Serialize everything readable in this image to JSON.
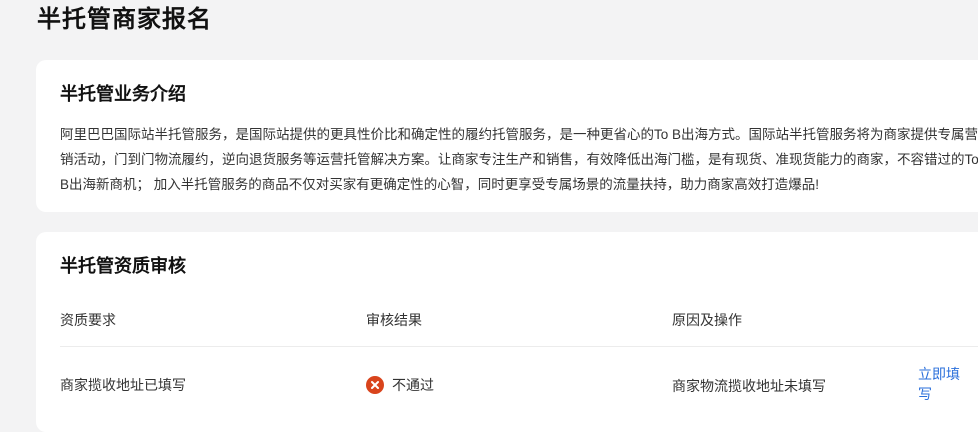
{
  "page": {
    "title": "半托管商家报名"
  },
  "intro": {
    "title": "半托管业务介绍",
    "text": "阿里巴巴国际站半托管服务，是国际站提供的更具性价比和确定性的履约托管服务，是一种更省心的To B出海方式。国际站半托管服务将为商家提供专属营销活动，门到门物流履约，逆向退货服务等运营托管解决方案。让商家专注生产和销售，有效降低出海门槛，是有现货、准现货能力的商家，不容错过的To B出海新商机； 加入半托管服务的商品不仅对买家有更确定性的心智，同时更享受专属场景的流量扶持，助力商家高效打造爆品!"
  },
  "review": {
    "title": "半托管资质审核",
    "columns": [
      "资质要求",
      "审核结果",
      "原因及操作"
    ],
    "rows": [
      {
        "requirement": "商家揽收地址已填写",
        "result": "不通过",
        "result_icon": "error-circle-icon",
        "result_color": "#d9441c",
        "reason": "商家物流揽收地址未填写",
        "action": "立即填写"
      }
    ]
  },
  "colors": {
    "link": "#2a6fdb",
    "background": "#f3f3f4",
    "card": "#ffffff"
  }
}
